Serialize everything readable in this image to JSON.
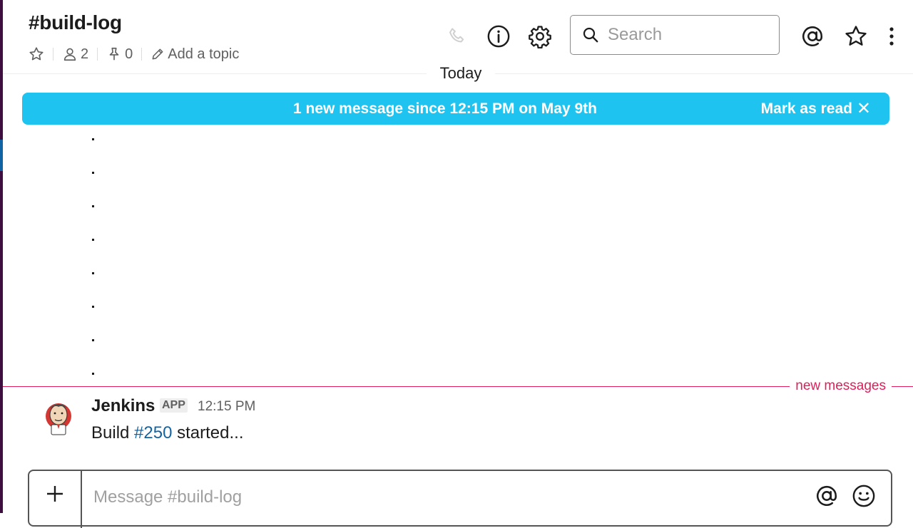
{
  "channel": {
    "name": "#build-log",
    "member_count": "2",
    "pinned_count": "0",
    "add_topic_label": "Add a topic"
  },
  "header": {
    "search_placeholder": "Search",
    "icons": [
      "phone-icon",
      "info-icon",
      "gear-icon",
      "search-icon",
      "mention-icon",
      "star-icon",
      "more-vertical-icon"
    ]
  },
  "day_divider": "Today",
  "banner": {
    "text": "1 new message since 12:15 PM on May 9th",
    "mark_read_label": "Mark as read",
    "close_glyph": "✕",
    "color": "#1fc3ef"
  },
  "new_messages_label": "new messages",
  "message": {
    "sender": "Jenkins",
    "badge": "APP",
    "time": "12:15 PM",
    "text_before": "Build ",
    "link": "#250",
    "text_after": " started..."
  },
  "composer": {
    "placeholder": "Message #build-log",
    "plus_glyph": "+"
  },
  "colors": {
    "sidebar": "#3f0e40",
    "new_divider": "#e01e5a",
    "link": "#1264a3"
  }
}
